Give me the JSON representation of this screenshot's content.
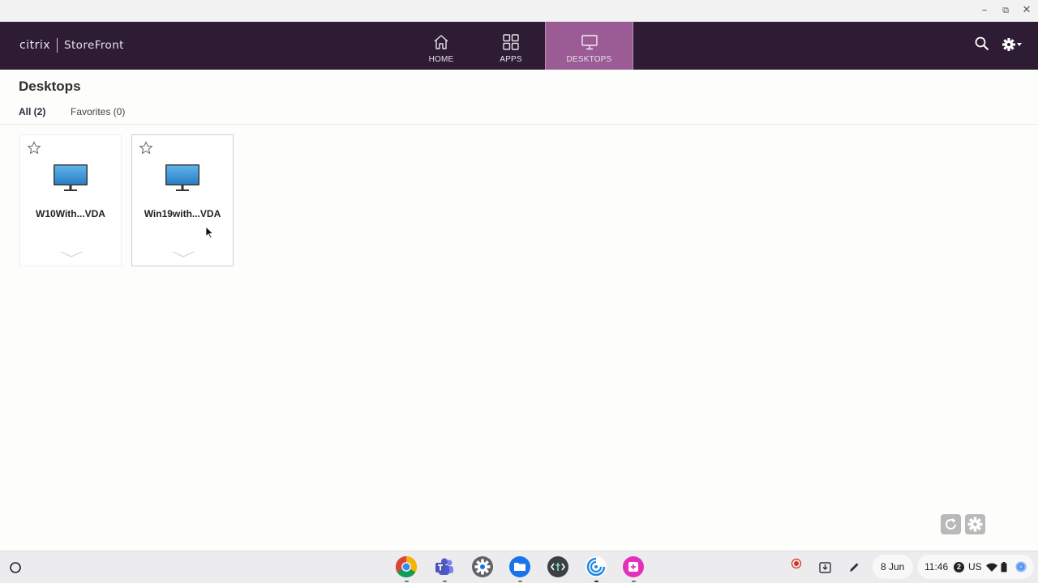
{
  "window": {
    "minimize_glyph": "–",
    "restore_glyph": "⧉",
    "close_glyph": "✕"
  },
  "header": {
    "brand": "citrix",
    "product": "StoreFront",
    "tabs": [
      {
        "label": "HOME",
        "icon": "home-icon",
        "active": false
      },
      {
        "label": "APPS",
        "icon": "apps-grid-icon",
        "active": false
      },
      {
        "label": "DESKTOPS",
        "icon": "desktop-monitor-icon",
        "active": true
      }
    ],
    "colors": {
      "bar": "#2e1c35",
      "active_tab": "#9b5b94"
    }
  },
  "page": {
    "title": "Desktops",
    "filters": [
      {
        "label": "All (2)",
        "active": true
      },
      {
        "label": "Favorites (0)",
        "active": false
      }
    ]
  },
  "desktops": [
    {
      "name": "W10With...VDA",
      "favorite": false
    },
    {
      "name": "Win19with...VDA",
      "favorite": false
    }
  ],
  "shelf": {
    "apps": [
      "chrome-icon",
      "teams-icon",
      "settings-icon",
      "files-icon",
      "terminal-icon",
      "citrix-workspace-icon",
      "canvas-app-icon"
    ],
    "date": "8 Jun",
    "time": "11:46",
    "notification_count": "2",
    "keyboard": "US"
  }
}
